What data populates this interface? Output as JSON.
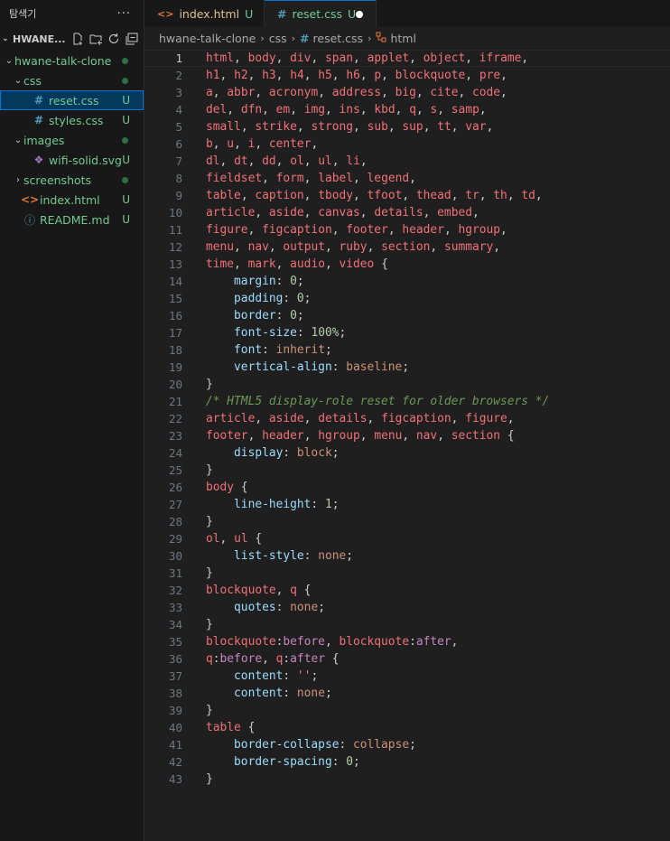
{
  "explorer": {
    "title": "탐색기",
    "more": "···",
    "project": "HWANE...",
    "tree": [
      {
        "label": "hwane-talk-clone",
        "indent": 0,
        "chev": "⌄",
        "icon": "",
        "status": "dot",
        "color": "green"
      },
      {
        "label": "css",
        "indent": 1,
        "chev": "⌄",
        "icon": "",
        "status": "dot",
        "color": "green"
      },
      {
        "label": "reset.css",
        "indent": 2,
        "chev": "",
        "icon": "hash",
        "status": "U",
        "color": "green",
        "selected": true
      },
      {
        "label": "styles.css",
        "indent": 2,
        "chev": "",
        "icon": "hash",
        "status": "U",
        "color": "green"
      },
      {
        "label": "images",
        "indent": 1,
        "chev": "⌄",
        "icon": "",
        "status": "dot",
        "color": "green"
      },
      {
        "label": "wifi-solid.svg",
        "indent": 2,
        "chev": "",
        "icon": "svg",
        "status": "U",
        "color": "green"
      },
      {
        "label": "screenshots",
        "indent": 1,
        "chev": "›",
        "icon": "",
        "status": "dot",
        "color": "green"
      },
      {
        "label": "index.html",
        "indent": 1,
        "chev": "",
        "icon": "html",
        "status": "U",
        "color": "green"
      },
      {
        "label": "README.md",
        "indent": 1,
        "chev": "",
        "icon": "info",
        "status": "U",
        "color": "green"
      }
    ]
  },
  "tabs": [
    {
      "label": "index.html",
      "status": "U",
      "icon": "html"
    },
    {
      "label": "reset.css",
      "status": "U",
      "icon": "hash",
      "modified": true
    }
  ],
  "breadcrumb": [
    "hwane-talk-clone",
    "css",
    "reset.css",
    "html"
  ],
  "editor": {
    "current_line": 1,
    "lines": [
      [
        [
          "tag",
          "html"
        ],
        [
          "punc",
          ", "
        ],
        [
          "tag",
          "body"
        ],
        [
          "punc",
          ", "
        ],
        [
          "tag",
          "div"
        ],
        [
          "punc",
          ", "
        ],
        [
          "tag",
          "span"
        ],
        [
          "punc",
          ", "
        ],
        [
          "tag",
          "applet"
        ],
        [
          "punc",
          ", "
        ],
        [
          "tag",
          "object"
        ],
        [
          "punc",
          ", "
        ],
        [
          "tag",
          "iframe"
        ],
        [
          "punc",
          ","
        ]
      ],
      [
        [
          "tag",
          "h1"
        ],
        [
          "punc",
          ", "
        ],
        [
          "tag",
          "h2"
        ],
        [
          "punc",
          ", "
        ],
        [
          "tag",
          "h3"
        ],
        [
          "punc",
          ", "
        ],
        [
          "tag",
          "h4"
        ],
        [
          "punc",
          ", "
        ],
        [
          "tag",
          "h5"
        ],
        [
          "punc",
          ", "
        ],
        [
          "tag",
          "h6"
        ],
        [
          "punc",
          ", "
        ],
        [
          "tag",
          "p"
        ],
        [
          "punc",
          ", "
        ],
        [
          "tag",
          "blockquote"
        ],
        [
          "punc",
          ", "
        ],
        [
          "tag",
          "pre"
        ],
        [
          "punc",
          ","
        ]
      ],
      [
        [
          "tag",
          "a"
        ],
        [
          "punc",
          ", "
        ],
        [
          "tag",
          "abbr"
        ],
        [
          "punc",
          ", "
        ],
        [
          "tag",
          "acronym"
        ],
        [
          "punc",
          ", "
        ],
        [
          "tag",
          "address"
        ],
        [
          "punc",
          ", "
        ],
        [
          "tag",
          "big"
        ],
        [
          "punc",
          ", "
        ],
        [
          "tag",
          "cite"
        ],
        [
          "punc",
          ", "
        ],
        [
          "tag",
          "code"
        ],
        [
          "punc",
          ","
        ]
      ],
      [
        [
          "tag",
          "del"
        ],
        [
          "punc",
          ", "
        ],
        [
          "tag",
          "dfn"
        ],
        [
          "punc",
          ", "
        ],
        [
          "tag",
          "em"
        ],
        [
          "punc",
          ", "
        ],
        [
          "tag",
          "img"
        ],
        [
          "punc",
          ", "
        ],
        [
          "tag",
          "ins"
        ],
        [
          "punc",
          ", "
        ],
        [
          "tag",
          "kbd"
        ],
        [
          "punc",
          ", "
        ],
        [
          "tag",
          "q"
        ],
        [
          "punc",
          ", "
        ],
        [
          "tag",
          "s"
        ],
        [
          "punc",
          ", "
        ],
        [
          "tag",
          "samp"
        ],
        [
          "punc",
          ","
        ]
      ],
      [
        [
          "tag",
          "small"
        ],
        [
          "punc",
          ", "
        ],
        [
          "tag",
          "strike"
        ],
        [
          "punc",
          ", "
        ],
        [
          "tag",
          "strong"
        ],
        [
          "punc",
          ", "
        ],
        [
          "tag",
          "sub"
        ],
        [
          "punc",
          ", "
        ],
        [
          "tag",
          "sup"
        ],
        [
          "punc",
          ", "
        ],
        [
          "tag",
          "tt"
        ],
        [
          "punc",
          ", "
        ],
        [
          "tag",
          "var"
        ],
        [
          "punc",
          ","
        ]
      ],
      [
        [
          "tag",
          "b"
        ],
        [
          "punc",
          ", "
        ],
        [
          "tag",
          "u"
        ],
        [
          "punc",
          ", "
        ],
        [
          "tag",
          "i"
        ],
        [
          "punc",
          ", "
        ],
        [
          "tag",
          "center"
        ],
        [
          "punc",
          ","
        ]
      ],
      [
        [
          "tag",
          "dl"
        ],
        [
          "punc",
          ", "
        ],
        [
          "tag",
          "dt"
        ],
        [
          "punc",
          ", "
        ],
        [
          "tag",
          "dd"
        ],
        [
          "punc",
          ", "
        ],
        [
          "tag",
          "ol"
        ],
        [
          "punc",
          ", "
        ],
        [
          "tag",
          "ul"
        ],
        [
          "punc",
          ", "
        ],
        [
          "tag",
          "li"
        ],
        [
          "punc",
          ","
        ]
      ],
      [
        [
          "tag",
          "fieldset"
        ],
        [
          "punc",
          ", "
        ],
        [
          "tag",
          "form"
        ],
        [
          "punc",
          ", "
        ],
        [
          "tag",
          "label"
        ],
        [
          "punc",
          ", "
        ],
        [
          "tag",
          "legend"
        ],
        [
          "punc",
          ","
        ]
      ],
      [
        [
          "tag",
          "table"
        ],
        [
          "punc",
          ", "
        ],
        [
          "tag",
          "caption"
        ],
        [
          "punc",
          ", "
        ],
        [
          "tag",
          "tbody"
        ],
        [
          "punc",
          ", "
        ],
        [
          "tag",
          "tfoot"
        ],
        [
          "punc",
          ", "
        ],
        [
          "tag",
          "thead"
        ],
        [
          "punc",
          ", "
        ],
        [
          "tag",
          "tr"
        ],
        [
          "punc",
          ", "
        ],
        [
          "tag",
          "th"
        ],
        [
          "punc",
          ", "
        ],
        [
          "tag",
          "td"
        ],
        [
          "punc",
          ","
        ]
      ],
      [
        [
          "tag",
          "article"
        ],
        [
          "punc",
          ", "
        ],
        [
          "tag",
          "aside"
        ],
        [
          "punc",
          ", "
        ],
        [
          "tag",
          "canvas"
        ],
        [
          "punc",
          ", "
        ],
        [
          "tag",
          "details"
        ],
        [
          "punc",
          ", "
        ],
        [
          "tag",
          "embed"
        ],
        [
          "punc",
          ","
        ]
      ],
      [
        [
          "tag",
          "figure"
        ],
        [
          "punc",
          ", "
        ],
        [
          "tag",
          "figcaption"
        ],
        [
          "punc",
          ", "
        ],
        [
          "tag",
          "footer"
        ],
        [
          "punc",
          ", "
        ],
        [
          "tag",
          "header"
        ],
        [
          "punc",
          ", "
        ],
        [
          "tag",
          "hgroup"
        ],
        [
          "punc",
          ","
        ]
      ],
      [
        [
          "tag",
          "menu"
        ],
        [
          "punc",
          ", "
        ],
        [
          "tag",
          "nav"
        ],
        [
          "punc",
          ", "
        ],
        [
          "tag",
          "output"
        ],
        [
          "punc",
          ", "
        ],
        [
          "tag",
          "ruby"
        ],
        [
          "punc",
          ", "
        ],
        [
          "tag",
          "section"
        ],
        [
          "punc",
          ", "
        ],
        [
          "tag",
          "summary"
        ],
        [
          "punc",
          ","
        ]
      ],
      [
        [
          "tag",
          "time"
        ],
        [
          "punc",
          ", "
        ],
        [
          "tag",
          "mark"
        ],
        [
          "punc",
          ", "
        ],
        [
          "tag",
          "audio"
        ],
        [
          "punc",
          ", "
        ],
        [
          "tag",
          "video"
        ],
        [
          "punc",
          " {"
        ]
      ],
      [
        [
          "punc",
          "    "
        ],
        [
          "prop",
          "margin"
        ],
        [
          "punc",
          ": "
        ],
        [
          "num",
          "0"
        ],
        [
          "punc",
          ";"
        ]
      ],
      [
        [
          "punc",
          "    "
        ],
        [
          "prop",
          "padding"
        ],
        [
          "punc",
          ": "
        ],
        [
          "num",
          "0"
        ],
        [
          "punc",
          ";"
        ]
      ],
      [
        [
          "punc",
          "    "
        ],
        [
          "prop",
          "border"
        ],
        [
          "punc",
          ": "
        ],
        [
          "num",
          "0"
        ],
        [
          "punc",
          ";"
        ]
      ],
      [
        [
          "punc",
          "    "
        ],
        [
          "prop",
          "font-size"
        ],
        [
          "punc",
          ": "
        ],
        [
          "num",
          "100%"
        ],
        [
          "punc",
          ";"
        ]
      ],
      [
        [
          "punc",
          "    "
        ],
        [
          "prop",
          "font"
        ],
        [
          "punc",
          ": "
        ],
        [
          "kw",
          "inherit"
        ],
        [
          "punc",
          ";"
        ]
      ],
      [
        [
          "punc",
          "    "
        ],
        [
          "prop",
          "vertical-align"
        ],
        [
          "punc",
          ": "
        ],
        [
          "kw",
          "baseline"
        ],
        [
          "punc",
          ";"
        ]
      ],
      [
        [
          "punc",
          "}"
        ]
      ],
      [
        [
          "cmt",
          "/* HTML5 display-role reset for older browsers */"
        ]
      ],
      [
        [
          "tag",
          "article"
        ],
        [
          "punc",
          ", "
        ],
        [
          "tag",
          "aside"
        ],
        [
          "punc",
          ", "
        ],
        [
          "tag",
          "details"
        ],
        [
          "punc",
          ", "
        ],
        [
          "tag",
          "figcaption"
        ],
        [
          "punc",
          ", "
        ],
        [
          "tag",
          "figure"
        ],
        [
          "punc",
          ","
        ]
      ],
      [
        [
          "tag",
          "footer"
        ],
        [
          "punc",
          ", "
        ],
        [
          "tag",
          "header"
        ],
        [
          "punc",
          ", "
        ],
        [
          "tag",
          "hgroup"
        ],
        [
          "punc",
          ", "
        ],
        [
          "tag",
          "menu"
        ],
        [
          "punc",
          ", "
        ],
        [
          "tag",
          "nav"
        ],
        [
          "punc",
          ", "
        ],
        [
          "tag",
          "section"
        ],
        [
          "punc",
          " {"
        ]
      ],
      [
        [
          "punc",
          "    "
        ],
        [
          "prop",
          "display"
        ],
        [
          "punc",
          ": "
        ],
        [
          "kw",
          "block"
        ],
        [
          "punc",
          ";"
        ]
      ],
      [
        [
          "punc",
          "}"
        ]
      ],
      [
        [
          "tag",
          "body"
        ],
        [
          "punc",
          " {"
        ]
      ],
      [
        [
          "punc",
          "    "
        ],
        [
          "prop",
          "line-height"
        ],
        [
          "punc",
          ": "
        ],
        [
          "num",
          "1"
        ],
        [
          "punc",
          ";"
        ]
      ],
      [
        [
          "punc",
          "}"
        ]
      ],
      [
        [
          "tag",
          "ol"
        ],
        [
          "punc",
          ", "
        ],
        [
          "tag",
          "ul"
        ],
        [
          "punc",
          " {"
        ]
      ],
      [
        [
          "punc",
          "    "
        ],
        [
          "prop",
          "list-style"
        ],
        [
          "punc",
          ": "
        ],
        [
          "kw",
          "none"
        ],
        [
          "punc",
          ";"
        ]
      ],
      [
        [
          "punc",
          "}"
        ]
      ],
      [
        [
          "tag",
          "blockquote"
        ],
        [
          "punc",
          ", "
        ],
        [
          "tag",
          "q"
        ],
        [
          "punc",
          " {"
        ]
      ],
      [
        [
          "punc",
          "    "
        ],
        [
          "prop",
          "quotes"
        ],
        [
          "punc",
          ": "
        ],
        [
          "kw",
          "none"
        ],
        [
          "punc",
          ";"
        ]
      ],
      [
        [
          "punc",
          "}"
        ]
      ],
      [
        [
          "tag",
          "blockquote"
        ],
        [
          "punc",
          ":"
        ],
        [
          "pseudo",
          "before"
        ],
        [
          "punc",
          ", "
        ],
        [
          "tag",
          "blockquote"
        ],
        [
          "punc",
          ":"
        ],
        [
          "pseudo",
          "after"
        ],
        [
          "punc",
          ","
        ]
      ],
      [
        [
          "tag",
          "q"
        ],
        [
          "punc",
          ":"
        ],
        [
          "pseudo",
          "before"
        ],
        [
          "punc",
          ", "
        ],
        [
          "tag",
          "q"
        ],
        [
          "punc",
          ":"
        ],
        [
          "pseudo",
          "after"
        ],
        [
          "punc",
          " {"
        ]
      ],
      [
        [
          "punc",
          "    "
        ],
        [
          "prop",
          "content"
        ],
        [
          "punc",
          ": "
        ],
        [
          "kw",
          "''"
        ],
        [
          "punc",
          ";"
        ]
      ],
      [
        [
          "punc",
          "    "
        ],
        [
          "prop",
          "content"
        ],
        [
          "punc",
          ": "
        ],
        [
          "kw",
          "none"
        ],
        [
          "punc",
          ";"
        ]
      ],
      [
        [
          "punc",
          "}"
        ]
      ],
      [
        [
          "tag",
          "table"
        ],
        [
          "punc",
          " {"
        ]
      ],
      [
        [
          "punc",
          "    "
        ],
        [
          "prop",
          "border-collapse"
        ],
        [
          "punc",
          ": "
        ],
        [
          "kw",
          "collapse"
        ],
        [
          "punc",
          ";"
        ]
      ],
      [
        [
          "punc",
          "    "
        ],
        [
          "prop",
          "border-spacing"
        ],
        [
          "punc",
          ": "
        ],
        [
          "num",
          "0"
        ],
        [
          "punc",
          ";"
        ]
      ],
      [
        [
          "punc",
          "}"
        ]
      ]
    ]
  }
}
